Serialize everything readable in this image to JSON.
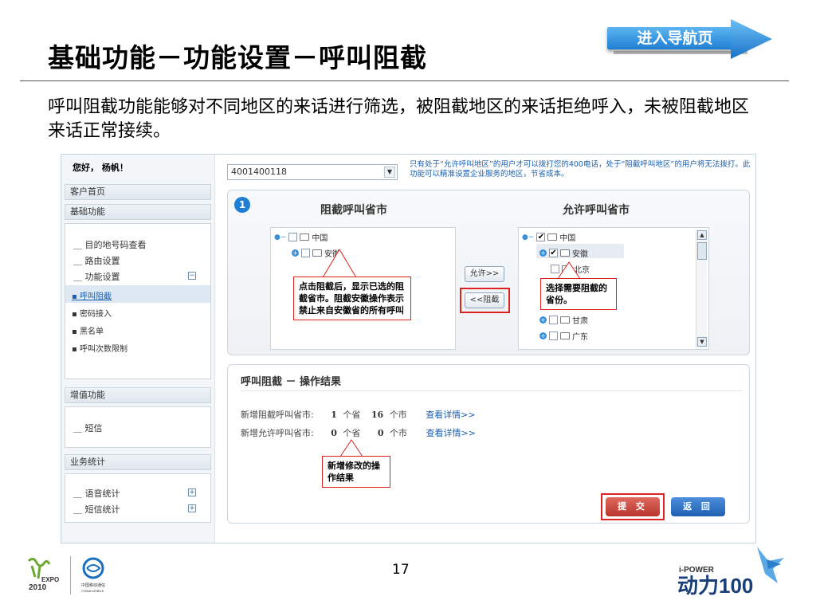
{
  "slide": {
    "title": "基础功能－功能设置－呼叫阻截",
    "nav_button": "进入导航页",
    "intro": "呼叫阻截功能能够对不同地区的来话进行筛选，被阻截地区的来话拒绝呼入，未被阻截地区来话正常接续。",
    "page_number": "17"
  },
  "sidebar": {
    "greeting": "您好， 杨帆！",
    "home": "客户首页",
    "basic_header": "基础功能",
    "basic_items": [
      "目的地号码查看",
      "路由设置",
      "功能设置"
    ],
    "sub_items": [
      "呼叫阻截",
      "密码接入",
      "黑名单",
      "呼叫次数限制"
    ],
    "value_header": "增值功能",
    "value_items": [
      "短信"
    ],
    "stats_header": "业务统计",
    "stats_items": [
      "语音统计",
      "短信统计"
    ]
  },
  "main": {
    "number_select": "4001400118",
    "note": "只有处于“允许呼叫地区”的用户才可以拨打您的400电话，处于“阻截呼叫地区”的用户将无法拨打。此功能可以精准设置企业服务的地区，节省成本。",
    "step": "1",
    "blocked_title": "阻截呼叫省市",
    "allowed_title": "允许呼叫省市",
    "blocked_tree": [
      "中国",
      "安徽"
    ],
    "allowed_tree": [
      "中国",
      "安徽",
      "北京",
      "甘肃",
      "广东"
    ],
    "allow_button": "允许>>",
    "block_button": "<<阻截",
    "callout_block": "点击阻截后，显示已选的阻截省市。阻截安徽操作表示禁止来自安徽省的所有呼叫",
    "callout_select": "选择需要阻截的省份。",
    "result_title": "呼叫阻截 － 操作结果",
    "row1": {
      "label": "新增阻截呼叫省市:",
      "prov": "1",
      "prov_unit": "个省",
      "city": "16",
      "city_unit": "个市",
      "link": "查看详情>>"
    },
    "row2": {
      "label": "新增允许呼叫省市:",
      "prov": "0",
      "prov_unit": "个省",
      "city": "0",
      "city_unit": "个市",
      "link": "查看详情>>"
    },
    "callout_result": "新增修改的操作结果",
    "submit": "提 交",
    "back": "返 回"
  },
  "footer": {
    "expo_text": "EXPO 2010",
    "cm_text": "中国移动通信 CHINA MOBILE",
    "brand_top": "i-POWER",
    "brand_main": "动力100"
  },
  "colors": {
    "accent": "#1f7fd3",
    "callout_border": "#dd2222",
    "submit": "#c9433a",
    "back": "#2a6fc0"
  }
}
